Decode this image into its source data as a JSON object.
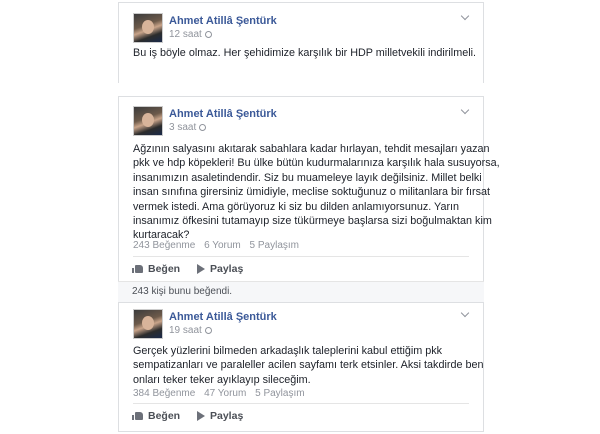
{
  "posts": [
    {
      "author": "Ahmet Atillâ Şentürk",
      "time": "12 saat",
      "lines": [
        "Bu iş böyle olmaz. Her şehidimize karşılık bir HDP milletvekili indirilmeli."
      ]
    },
    {
      "author": "Ahmet Atillâ Şentürk",
      "time": "3 saat",
      "lines": [
        "Ağzının salyasını akıtarak sabahlara kadar hırlayan, tehdit mesajları yazan",
        "pkk ve hdp köpekleri! Bu ülke bütün kudurmalarınıza karşılık hala susuyorsa,",
        "insanımızın asaletindendir. Siz bu muameleye layık değilsiniz. Millet belki",
        "insan sınıfına girersiniz ümidiyle, meclise soktuğunuz o militanlara bir fırsat",
        "vermek istedi. Ama görüyoruz ki siz bu dilden anlamıyorsunuz. Yarın",
        "insanımız öfkesini tutamayıp size tükürmeye başlarsa sizi boğulmaktan kim",
        "kurtaracak?"
      ],
      "stats": {
        "likes": "243 Beğenme",
        "comments": "6 Yorum",
        "shares": "5 Paylaşım"
      },
      "actions": {
        "like": "Beğen",
        "share": "Paylaş"
      },
      "liked_by": "243 kişi bunu beğendi."
    },
    {
      "author": "Ahmet Atillâ Şentürk",
      "time": "19 saat",
      "lines": [
        "Gerçek yüzlerini bilmeden arkadaşlık taleplerini kabul ettiğim pkk",
        "sempatizanları ve paraleller acilen sayfamı terk etsinler. Aksi takdirde ben",
        "onları teker teker ayıklayıp sileceğim."
      ],
      "stats": {
        "likes": "384 Beğenme",
        "comments": "47 Yorum",
        "shares": "5 Paylaşım"
      },
      "actions": {
        "like": "Beğen",
        "share": "Paylaş"
      }
    }
  ]
}
